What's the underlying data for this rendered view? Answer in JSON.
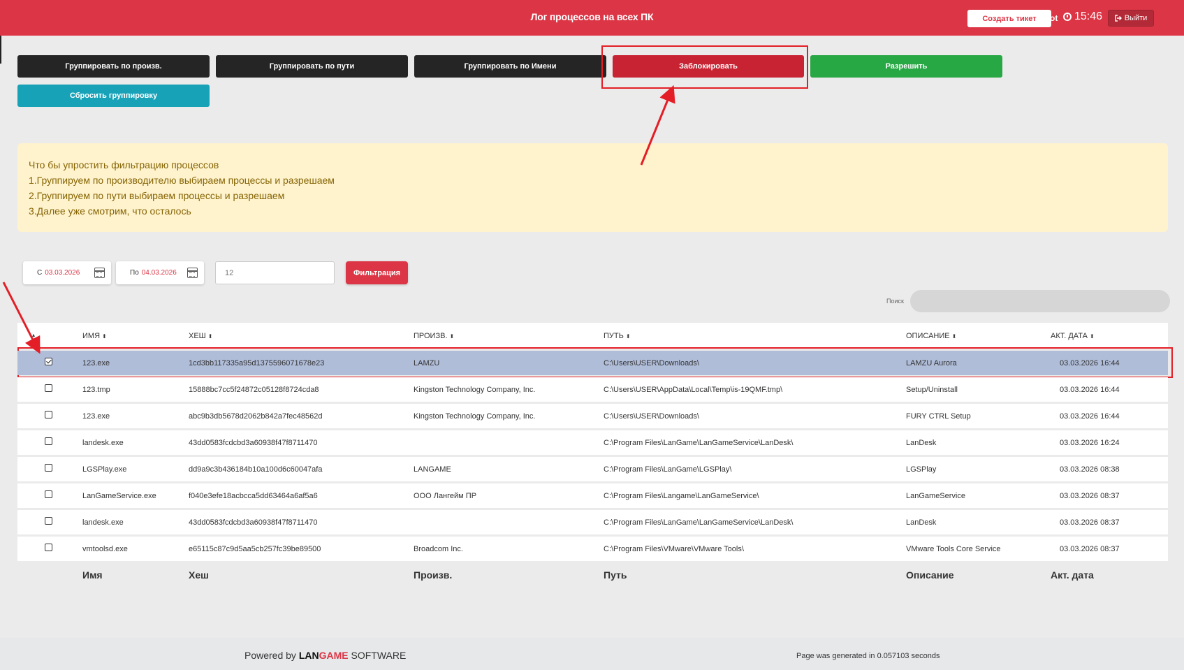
{
  "header": {
    "title": "Лог процессов на всех ПК",
    "create_ticket": "Создать тикет",
    "user": "Root",
    "time": "15:46",
    "logout": "Выйти"
  },
  "toolbar": {
    "group_vendor": "Группировать по произв.",
    "group_path": "Группировать по пути",
    "group_name": "Группировать по Имени",
    "block": "Заблокировать",
    "allow": "Разрешить",
    "reset_group": "Сбросить группировку"
  },
  "info": {
    "lines": [
      "Что бы упростить фильтрацию процессов",
      "1.Группируем по производителю выбираем процессы и разрешаем",
      "2.Группируем по пути выбираем процессы и разрешаем",
      "3.Далее уже смотрим, что осталось"
    ]
  },
  "filter": {
    "from_prefix": "С",
    "from_date": "03.03.2026",
    "to_prefix": "По",
    "to_date": "04.03.2026",
    "count_placeholder": "12",
    "filter_button": "Фильтрация",
    "search_label": "Поиск"
  },
  "table": {
    "headers": [
      "ИМЯ",
      "ХЕШ",
      "ПРОИЗВ.",
      "ПУТЬ",
      "ОПИСАНИЕ",
      "АКТ. ДАТА"
    ],
    "footers": [
      "Имя",
      "Хеш",
      "Произв.",
      "Путь",
      "Описание",
      "Акт. дата"
    ],
    "rows": [
      {
        "checked": true,
        "name": "123.exe",
        "hash": "1cd3bb117335a95d1375596071678e23",
        "vendor": "LAMZU",
        "path": "C:\\Users\\USER\\Downloads\\",
        "desc": "LAMZU Aurora",
        "date": "03.03.2026 16:44"
      },
      {
        "checked": false,
        "name": "123.tmp",
        "hash": "15888bc7cc5f24872c05128f8724cda8",
        "vendor": "Kingston Technology Company, Inc.",
        "path": "C:\\Users\\USER\\AppData\\Local\\Temp\\is-19QMF.tmp\\",
        "desc": "Setup/Uninstall",
        "date": "03.03.2026 16:44"
      },
      {
        "checked": false,
        "name": "123.exe",
        "hash": "abc9b3db5678d2062b842a7fec48562d",
        "vendor": "Kingston Technology Company, Inc.",
        "path": "C:\\Users\\USER\\Downloads\\",
        "desc": "FURY CTRL Setup",
        "date": "03.03.2026 16:44"
      },
      {
        "checked": false,
        "name": "landesk.exe",
        "hash": "43dd0583fcdcbd3a60938f47f8711470",
        "vendor": "",
        "path": "C:\\Program Files\\LanGame\\LanGameService\\LanDesk\\",
        "desc": "LanDesk",
        "date": "03.03.2026 16:24"
      },
      {
        "checked": false,
        "name": "LGSPlay.exe",
        "hash": "dd9a9c3b436184b10a100d6c60047afa",
        "vendor": "LANGAME",
        "path": "C:\\Program Files\\LanGame\\LGSPlay\\",
        "desc": "LGSPlay",
        "date": "03.03.2026 08:38"
      },
      {
        "checked": false,
        "name": "LanGameService.exe",
        "hash": "f040e3efe18acbcca5dd63464a6af5a6",
        "vendor": "ООО Лангейм ПР",
        "path": "C:\\Program Files\\Langame\\LanGameService\\",
        "desc": "LanGameService",
        "date": "03.03.2026 08:37"
      },
      {
        "checked": false,
        "name": "landesk.exe",
        "hash": "43dd0583fcdcbd3a60938f47f8711470",
        "vendor": "",
        "path": "C:\\Program Files\\LanGame\\LanGameService\\LanDesk\\",
        "desc": "LanDesk",
        "date": "03.03.2026 08:37"
      },
      {
        "checked": false,
        "name": "vmtoolsd.exe",
        "hash": "e65115c87c9d5aa5cb257fc39be89500",
        "vendor": "Broadcom Inc.",
        "path": "C:\\Program Files\\VMware\\VMware Tools\\",
        "desc": "VMware Tools Core Service",
        "date": "03.03.2026 08:37"
      }
    ]
  },
  "footer": {
    "powered_by": "Powered by",
    "brand_lan": "LAN",
    "brand_game": "GAME",
    "brand_software": "SOFTWARE",
    "generated": "Page was generated in 0.057103 seconds"
  },
  "colors": {
    "primary_red": "#dc3545",
    "success_green": "#28a745",
    "info_cyan": "#17a2b8",
    "dark": "#252525",
    "selected_row": "#b0bdd9",
    "annotation_red": "#e41e26"
  },
  "icons": [
    "clock-icon",
    "logout-icon",
    "calendar-icon",
    "sort-icon",
    "checkbox-icon",
    "annotation-arrow"
  ]
}
